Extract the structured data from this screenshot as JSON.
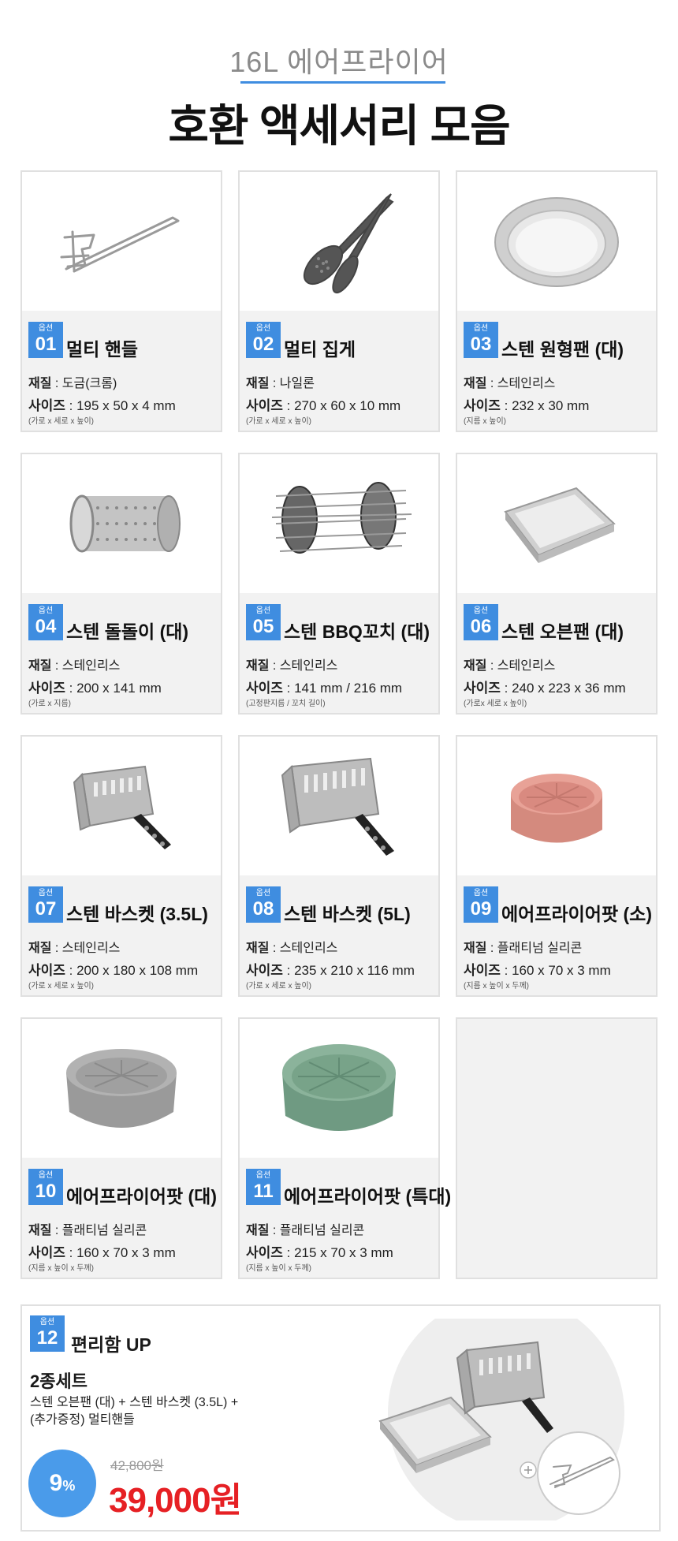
{
  "header": {
    "subtitle": "16L 에어프라이어",
    "title": "호환 액세서리 모음"
  },
  "option_label": "옵션",
  "material_label": "재질",
  "size_label": "사이즈",
  "items": [
    {
      "num": "01",
      "name": "멀티 핸들",
      "material": " : 도금(크롬)",
      "size": " : 195 x 50 x 4 mm",
      "note": "(가로 x 세로 x 높이)"
    },
    {
      "num": "02",
      "name": "멀티 집게",
      "material": " : 나일론",
      "size": " : 270 x 60 x 10 mm",
      "note": "(가로 x 세로 x 높이)"
    },
    {
      "num": "03",
      "name": "스텐 원형팬 (대)",
      "material": " : 스테인리스",
      "size": " : 232 x 30 mm",
      "note": "(지름 x 높이)"
    },
    {
      "num": "04",
      "name": "스텐 돌돌이 (대)",
      "material": " : 스테인리스",
      "size": " : 200 x 141 mm",
      "note": "(가로 x 지름)"
    },
    {
      "num": "05",
      "name": "스텐 BBQ꼬치 (대)",
      "material": " : 스테인리스",
      "size": " : 141 mm /  216 mm",
      "note": "(고정판지름 / 꼬치 길이)"
    },
    {
      "num": "06",
      "name": "스텐 오븐팬 (대)",
      "material": " : 스테인리스",
      "size": " : 240 x 223 x 36 mm",
      "note": "(가로x 세로 x 높이)"
    },
    {
      "num": "07",
      "name": "스텐 바스켓 (3.5L)",
      "material": " : 스테인리스",
      "size": " : 200 x 180 x 108 mm",
      "note": "(가로 x 세로 x 높이)"
    },
    {
      "num": "08",
      "name": "스텐 바스켓 (5L)",
      "material": " : 스테인리스",
      "size": " : 235 x 210 x 116 mm",
      "note": "(가로 x 세로 x 높이)"
    },
    {
      "num": "09",
      "name": "에어프라이어팟 (소)",
      "material": " : 플래티넘 실리콘",
      "size": " : 160 x 70 x 3 mm",
      "note": "(지름 x 높이 x 두께)"
    },
    {
      "num": "10",
      "name": "에어프라이어팟 (대)",
      "material": " : 플래티넘 실리콘",
      "size": " : 160 x 70 x 3 mm",
      "note": "(지름 x 높이 x 두께)"
    },
    {
      "num": "11",
      "name": "에어프라이어팟 (특대)",
      "material": " : 플래티넘 실리콘",
      "size": " : 215 x 70 x 3 mm",
      "note": "(지름 x 높이 x 두께)"
    }
  ],
  "set": {
    "num": "12",
    "name": "편리함 UP",
    "subtitle": "2종세트",
    "desc_line1": "스텐 오븐팬 (대) + 스텐 바스켓 (3.5L) +",
    "desc_line2": "(추가증정) 멀티핸들",
    "discount": "9",
    "discount_unit": "%",
    "old_price": "42,800원",
    "new_price": "39,000원"
  },
  "colors": {
    "accent": "#3f8de0",
    "price": "#e62024",
    "card_info_bg": "#f2f2f2"
  }
}
